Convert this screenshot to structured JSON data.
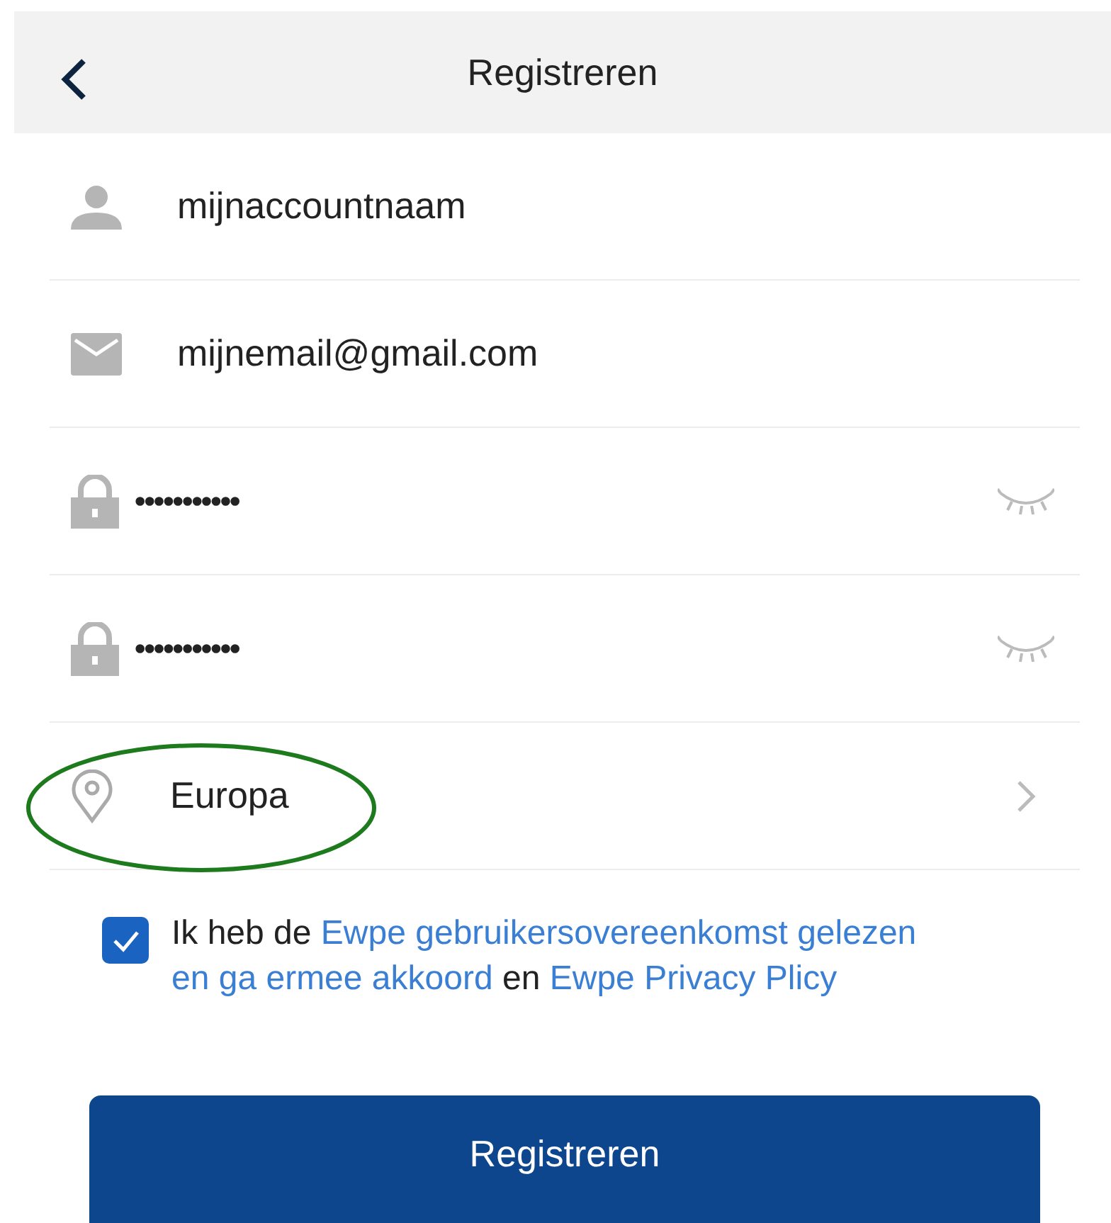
{
  "header": {
    "title": "Registreren"
  },
  "fields": [
    {
      "kind": "user",
      "value": "mijnaccountnaam"
    },
    {
      "kind": "email",
      "value": "mijnemail@gmail.com"
    },
    {
      "kind": "password",
      "value": "•••••••••••"
    },
    {
      "kind": "password",
      "value": "•••••••••••"
    },
    {
      "kind": "region",
      "value": "Europa"
    }
  ],
  "agreement": {
    "checked": true,
    "parts": [
      {
        "kind": "text",
        "text": "Ik heb de"
      },
      {
        "kind": "link",
        "text": "Ewpe gebruikersovereenkomst gelezen"
      },
      {
        "kind": "link",
        "text": "en ga ermee akkoord"
      },
      {
        "kind": "text",
        "text": "en"
      },
      {
        "kind": "link",
        "text": "Ewpe Privacy Plicy"
      }
    ]
  },
  "submit": {
    "label": "Registreren"
  }
}
